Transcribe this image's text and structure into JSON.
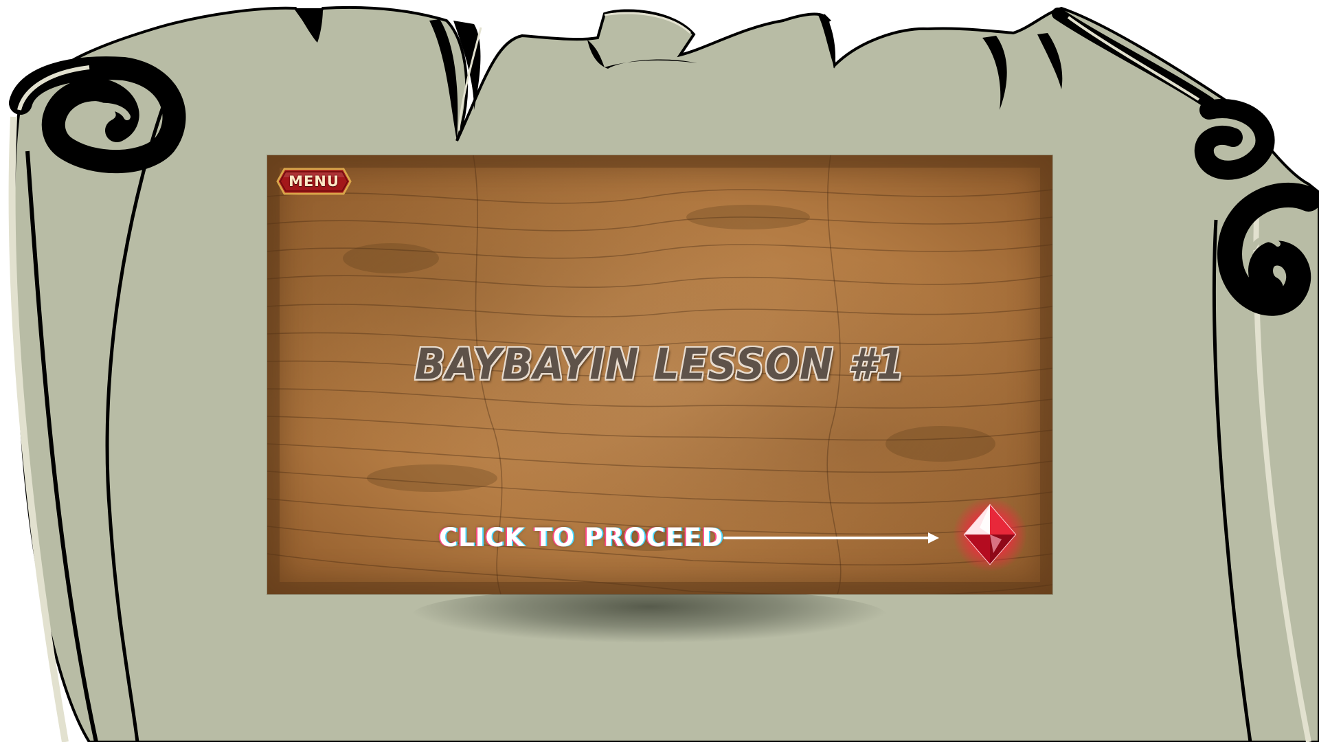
{
  "scene": {
    "background_color": "#ffffff",
    "parchment_color": "#b8bca5",
    "parchment_highlight": "#e2e1cf",
    "ink_color": "#000000"
  },
  "game_panel": {
    "wood_color": "#b27a42",
    "menu_button": {
      "label": "MENU",
      "fill_color": "#a3171a",
      "border_color": "#d9a54a"
    },
    "title": "BAYBAYIN LESSON #1",
    "title_color": "#5e5249",
    "proceed": {
      "label": "CLICK TO PROCEED",
      "arrow_icon": "right-arrow-icon",
      "button_icon": "red-crystal-gem-icon",
      "gem_color": "#e8283a"
    }
  }
}
